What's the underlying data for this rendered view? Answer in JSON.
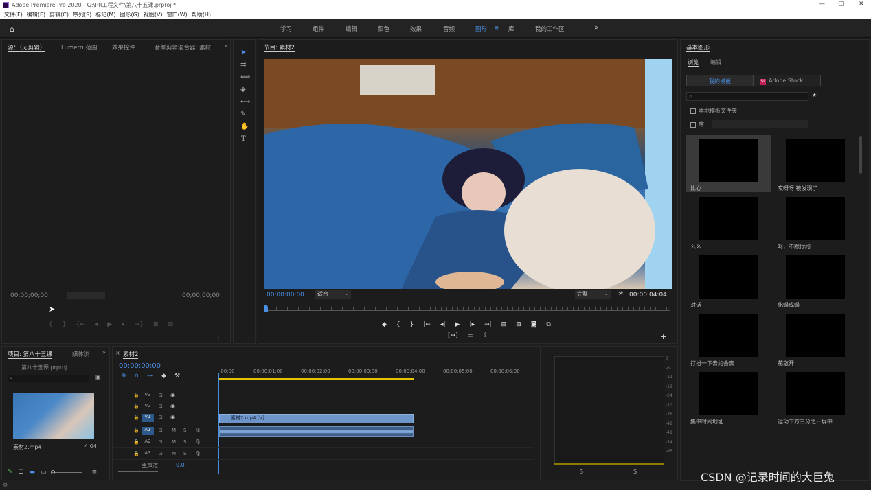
{
  "window": {
    "title": "Adobe Premiere Pro 2020 - G:\\PR工程文件\\第八十五课.prproj *"
  },
  "menu": [
    "文件(F)",
    "编辑(E)",
    "剪辑(C)",
    "序列(S)",
    "标记(M)",
    "图形(G)",
    "视图(V)",
    "窗口(W)",
    "帮助(H)"
  ],
  "workspaces": [
    "学习",
    "组件",
    "编辑",
    "颜色",
    "效果",
    "音频",
    "图形",
    "库",
    "我的工作区"
  ],
  "active_workspace": "图形",
  "source_panel": {
    "tabs": [
      "源：（无剪辑）",
      "Lumetri 范围",
      "效果控件",
      "音频剪辑混合器: 素材"
    ],
    "tc_left": "00;00;00;00",
    "tc_right": "00;00;00;00"
  },
  "program_panel": {
    "title": "节目: 素材2",
    "tc_in": "00:00:00:00",
    "fit": "适合",
    "quality": "完整",
    "tc_dur": "00:00:04:04"
  },
  "essential_graphics": {
    "title": "基本图形",
    "tabs": [
      "浏览",
      "编辑"
    ],
    "source_tabs": [
      "我的模板",
      "Adobe Stock"
    ],
    "checkbox_local": "本地模板文件夹",
    "checkbox_lib": "库",
    "templates": [
      "比心",
      "哎呀呀 被发现了",
      "么么",
      "呵，不跟你约",
      "对话",
      "化蝶成蝶",
      "打扮一下去约会去",
      "花散开",
      "集中时间地址",
      "运动下方三分之一屏中"
    ]
  },
  "project_panel": {
    "tabs": [
      "项目: 第八十五课",
      "媒体浏"
    ],
    "file": "第八十五课.prproj",
    "clip_name": "素材2.mp4",
    "clip_dur": "4:04"
  },
  "timeline": {
    "tab": "素材2",
    "tc": "00:00:00:00",
    "ruler": [
      ":00:00",
      "00:00:01:00",
      "00:00:02:00",
      "00:00:03:00",
      "00:00:04:00",
      "00:00:05:00",
      "00:00:06:00"
    ],
    "video_tracks": [
      "V3",
      "V2",
      "V1"
    ],
    "audio_tracks": [
      "A1",
      "A2",
      "A3"
    ],
    "master": "主声道",
    "master_val": "0.0",
    "clip": "素材2.mp4 [V]"
  },
  "meter": {
    "scale": [
      "0",
      "-6",
      "-12",
      "-18",
      "-24",
      "-30",
      "-36",
      "-42",
      "-48",
      "-54",
      "-dB"
    ],
    "s": "S"
  },
  "watermark": "CSDN @记录时间的大巨兔"
}
